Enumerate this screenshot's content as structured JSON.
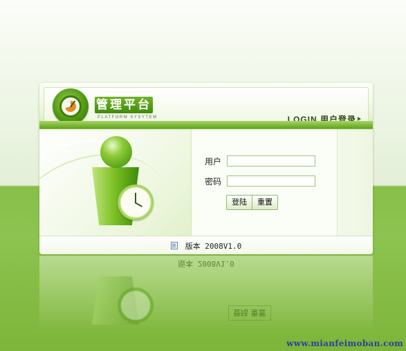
{
  "header": {
    "brand_title": "管理平台",
    "brand_subtitle": "PLATFORM SYSYTEM",
    "login_title": "LOGIN 用户登录"
  },
  "form": {
    "username_label": "用户",
    "username_value": "",
    "password_label": "密码",
    "password_value": "",
    "login_button": "登陆",
    "reset_button": "重置"
  },
  "footer": {
    "version_text": "版本 2008V1.0"
  },
  "watermark": "www.mianfeimoban.com",
  "icons": {
    "logo": "gauge-logo-icon",
    "illustration": "user-with-clock-icon",
    "arrow": "triangle-right-icon",
    "version": "document-icon"
  },
  "colors": {
    "accent": "#5fa418",
    "brand_box": "#4c940f",
    "background_lower": "#88bf4a",
    "watermark": "#2f3f9a"
  }
}
